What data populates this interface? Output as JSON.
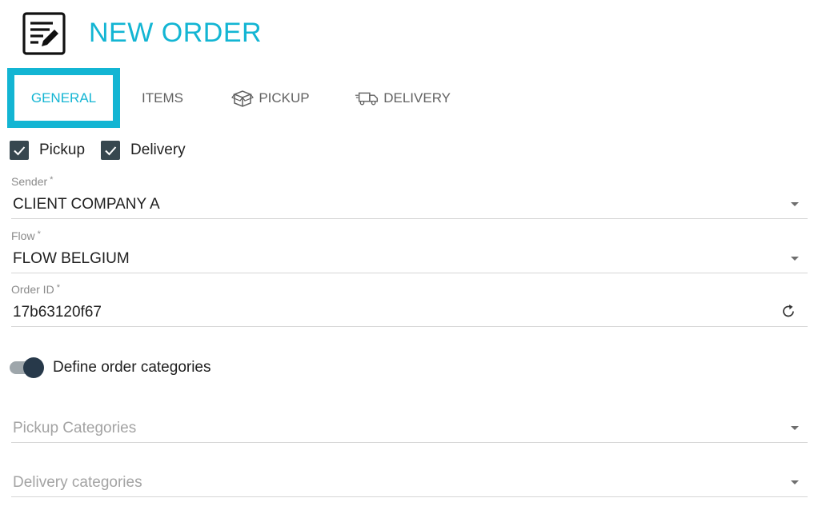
{
  "header": {
    "title": "NEW ORDER",
    "icon": "edit-document-icon"
  },
  "tabs": [
    {
      "label": "GENERAL",
      "active": true
    },
    {
      "label": "ITEMS",
      "active": false
    },
    {
      "label": "PICKUP",
      "icon": "box-icon",
      "active": false
    },
    {
      "label": "DELIVERY",
      "icon": "truck-icon",
      "active": false
    }
  ],
  "checkboxes": {
    "pickup": {
      "label": "Pickup",
      "checked": true
    },
    "delivery": {
      "label": "Delivery",
      "checked": true
    }
  },
  "fields": {
    "sender": {
      "label": "Sender",
      "required": "*",
      "value": "CLIENT COMPANY A"
    },
    "flow": {
      "label": "Flow",
      "required": "*",
      "value": "FLOW BELGIUM"
    },
    "order_id": {
      "label": "Order ID",
      "required": "*",
      "value": "17b63120f67"
    }
  },
  "toggle": {
    "label": "Define order categories",
    "on": true
  },
  "categories": {
    "pickup_placeholder": "Pickup Categories",
    "delivery_placeholder": "Delivery categories"
  },
  "colors": {
    "accent": "#13b5d3",
    "checkbox": "#37474f",
    "toggle_thumb": "#27394a"
  }
}
